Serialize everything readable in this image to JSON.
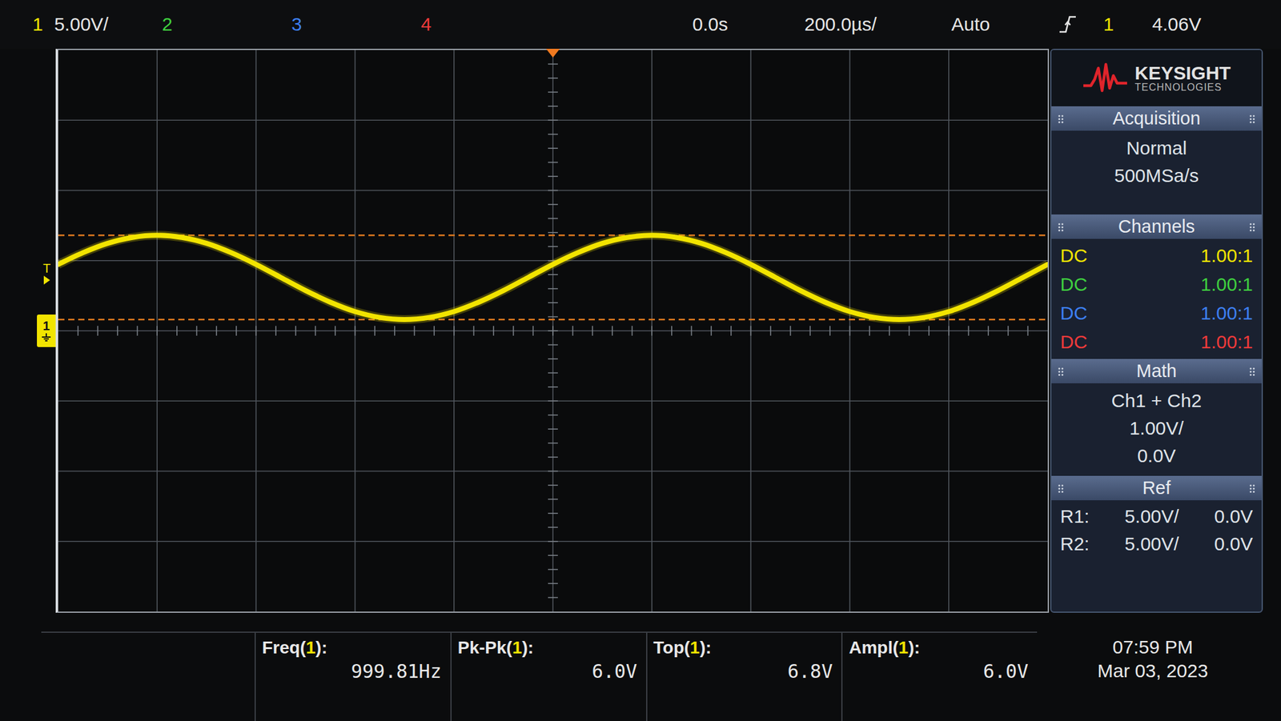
{
  "brand": {
    "name": "KEYSIGHT",
    "sub": "TECHNOLOGIES"
  },
  "channels": [
    {
      "number": "1",
      "scale": "5.00V/",
      "coupling": "DC",
      "probe": "1.00:1",
      "color": "#f2e400"
    },
    {
      "number": "2",
      "coupling": "DC",
      "probe": "1.00:1",
      "color": "#3fcf3f"
    },
    {
      "number": "3",
      "coupling": "DC",
      "probe": "1.00:1",
      "color": "#3d7ff2"
    },
    {
      "number": "4",
      "coupling": "DC",
      "probe": "1.00:1",
      "color": "#ee3a3a"
    }
  ],
  "timebase": {
    "position": "0.0s",
    "scale": "200.0µs/"
  },
  "trigger": {
    "mode": "Auto",
    "source": "1",
    "level": "4.06V",
    "marker": "T",
    "level_v": 4.06
  },
  "panel": {
    "acquisition": {
      "title": "Acquisition",
      "mode": "Normal",
      "rate": "500MSa/s"
    },
    "channels_title": "Channels",
    "math": {
      "title": "Math",
      "expression": "Ch1 + Ch2",
      "scale": "1.00V/",
      "offset": "0.0V"
    },
    "ref": {
      "title": "Ref",
      "rows": [
        {
          "label": "R1:",
          "scale": "5.00V/",
          "offset": "0.0V"
        },
        {
          "label": "R2:",
          "scale": "5.00V/",
          "offset": "0.0V"
        }
      ]
    }
  },
  "chart": {
    "volts_per_div": 5,
    "us_per_div": 200,
    "x_start_us": -1000,
    "x_step_us": 50,
    "ground_marker": {
      "label": "1",
      "offset_v": 0
    },
    "measure_lines_v": [
      6.8,
      0.8
    ],
    "series": [
      {
        "channel": "1",
        "values": [
          4.73,
          5.56,
          6.23,
          6.65,
          6.8,
          6.65,
          6.23,
          5.56,
          4.73,
          3.8,
          2.87,
          2.04,
          1.37,
          0.95,
          0.8,
          0.95,
          1.37,
          2.04,
          2.87,
          3.8,
          4.73,
          5.56,
          6.23,
          6.65,
          6.8,
          6.65,
          6.23,
          5.56,
          4.73,
          3.8,
          2.87,
          2.04,
          1.37,
          0.95,
          0.8,
          0.95,
          1.37,
          2.04,
          2.87,
          3.8,
          4.73
        ]
      }
    ]
  },
  "measurements": [
    {
      "label": [
        "Freq(",
        "1",
        "):"
      ],
      "value": "999.81Hz"
    },
    {
      "label": [
        "Pk-Pk(",
        "1",
        "):"
      ],
      "value": "6.0V"
    },
    {
      "label": [
        "Top(",
        "1",
        "):"
      ],
      "value": "6.8V"
    },
    {
      "label": [
        "Ampl(",
        "1",
        "):"
      ],
      "value": "6.0V"
    }
  ],
  "clock": {
    "time": "07:59 PM",
    "date": "Mar 03, 2023"
  }
}
